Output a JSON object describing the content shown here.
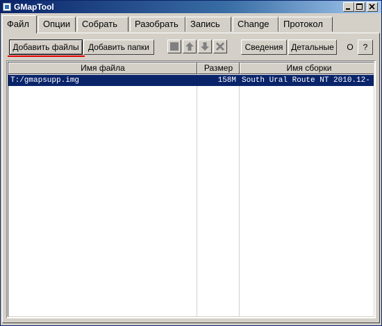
{
  "window": {
    "title": "GMapTool"
  },
  "tabs": [
    {
      "label": "Файл"
    },
    {
      "label": "Опции"
    },
    {
      "label": "Собрать"
    },
    {
      "label": "Разобрать"
    },
    {
      "label": "Запись"
    },
    {
      "label": "Change"
    },
    {
      "label": "Протокол"
    }
  ],
  "toolbar": {
    "add_files": "Добавить файлы",
    "add_folders": "Добавить папки",
    "info": "Сведения",
    "details": "Детальные",
    "o_label": "O",
    "help": "?"
  },
  "file_list": {
    "columns": [
      "Имя файла",
      "Размер",
      "Имя сборки"
    ],
    "rows": [
      {
        "name": "T:/gmapsupp.img",
        "size": "158M",
        "build": "South Ural Route NT 2010.12-"
      }
    ]
  },
  "colors": {
    "selection": "#0a246a",
    "highlight_line": "#e00000"
  }
}
